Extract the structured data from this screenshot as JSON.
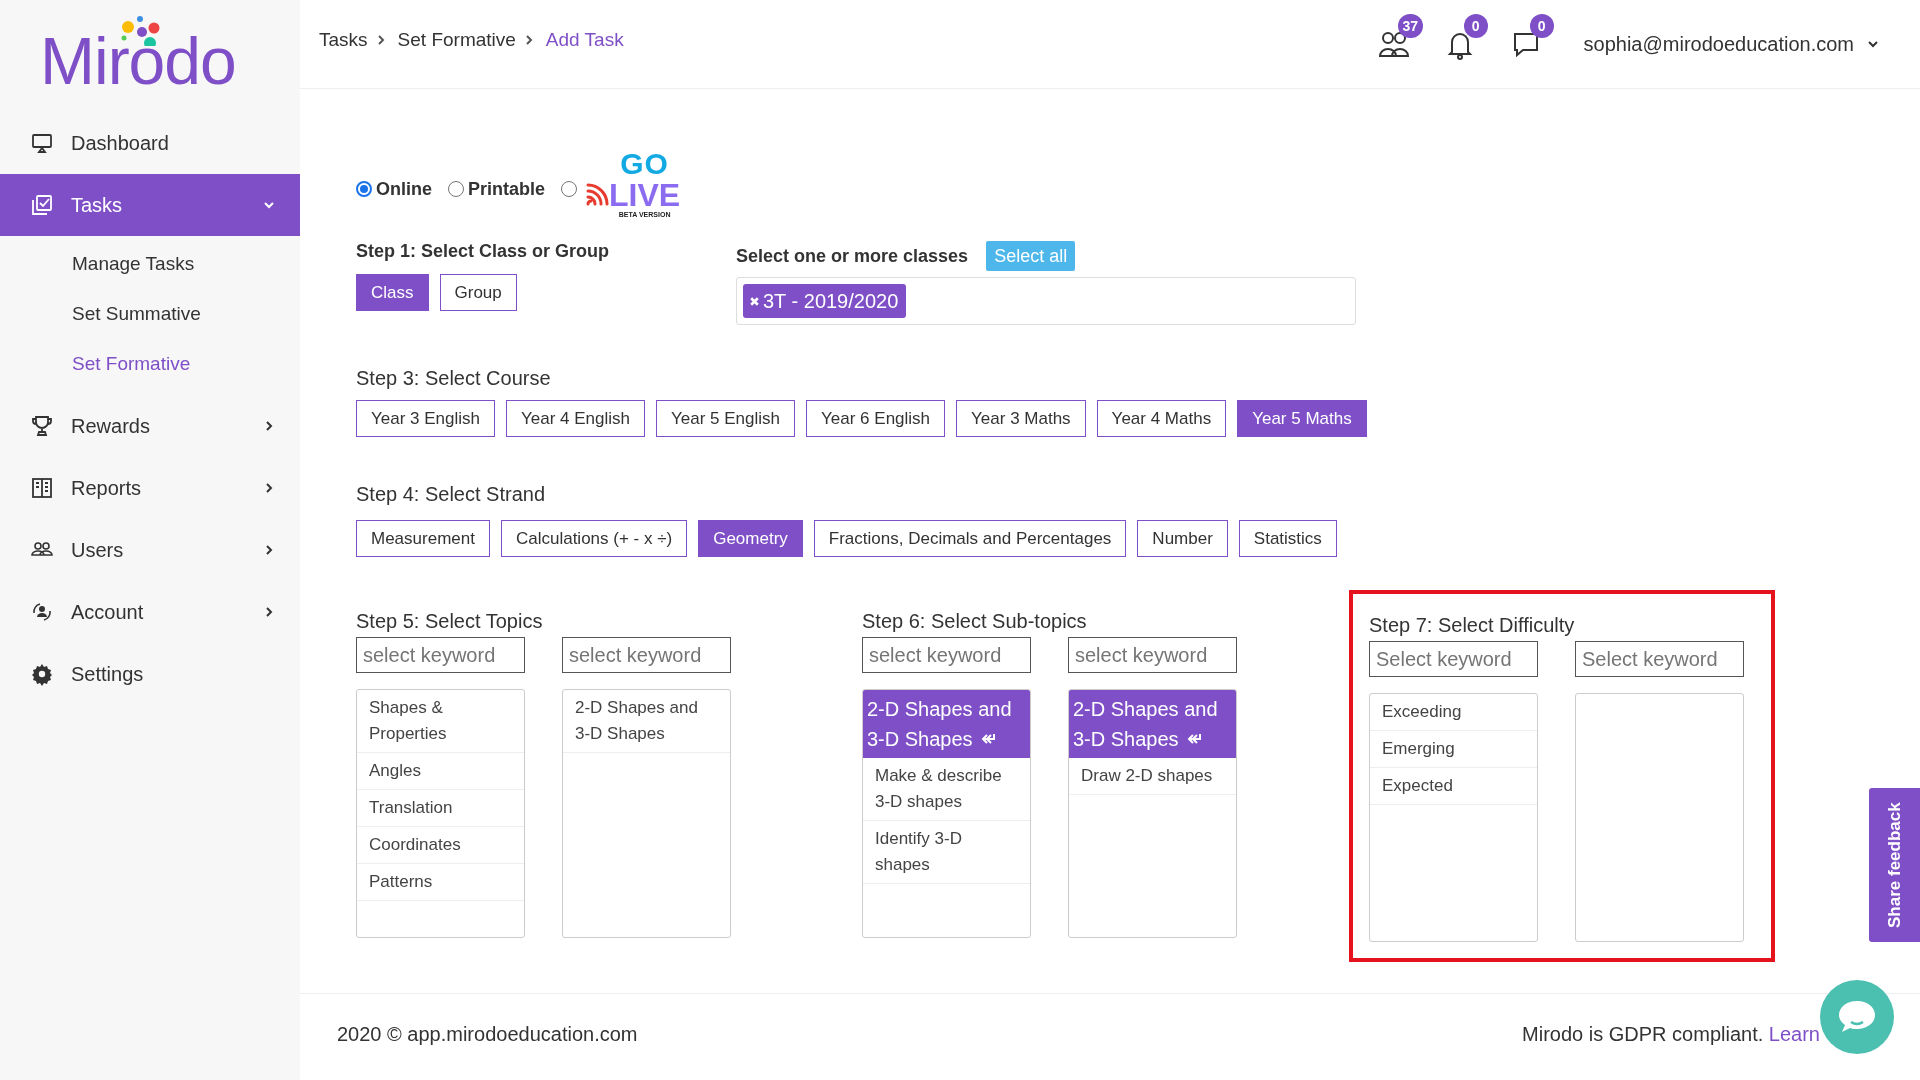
{
  "logo": "Mirodo",
  "sidebar": {
    "items": [
      {
        "label": "Dashboard",
        "kind": "link",
        "selected": false
      },
      {
        "label": "Tasks",
        "kind": "menu",
        "selected": true,
        "expanded": true,
        "children": [
          {
            "label": "Manage Tasks",
            "selected": false
          },
          {
            "label": "Set Summative",
            "selected": false
          },
          {
            "label": "Set Formative",
            "selected": true
          }
        ]
      },
      {
        "label": "Rewards",
        "kind": "menu",
        "selected": false,
        "expanded": false
      },
      {
        "label": "Reports",
        "kind": "menu",
        "selected": false,
        "expanded": false
      },
      {
        "label": "Users",
        "kind": "menu",
        "selected": false,
        "expanded": false
      },
      {
        "label": "Account",
        "kind": "menu",
        "selected": false,
        "expanded": false
      },
      {
        "label": "Settings",
        "kind": "link",
        "selected": false
      }
    ]
  },
  "header": {
    "breadcrumb": [
      {
        "label": "Tasks",
        "current": false
      },
      {
        "label": "Set Formative",
        "current": false
      },
      {
        "label": "Add Task",
        "current": true
      }
    ],
    "badges": [
      "37",
      "0",
      "0"
    ],
    "user": "sophia@mirodoeducation.com"
  },
  "task_type": {
    "options": [
      {
        "kind": "text",
        "label": "Online",
        "selected": true
      },
      {
        "kind": "text",
        "label": "Printable",
        "selected": false
      },
      {
        "kind": "logo",
        "top": "GO",
        "main": "LIVE",
        "note": "BETA VERSION",
        "selected": false
      }
    ]
  },
  "step1": {
    "title": "Step 1: Select Class or Group",
    "options": [
      {
        "label": "Class",
        "selected": true
      },
      {
        "label": "Group",
        "selected": false
      }
    ]
  },
  "classes": {
    "label": "Select one or more classes",
    "select_all": "Select all",
    "tags": [
      "3T - 2019/2020"
    ]
  },
  "step3": {
    "title": "Step 3: Select Course",
    "options": [
      {
        "label": "Year 3 English",
        "selected": false
      },
      {
        "label": "Year 4 English",
        "selected": false
      },
      {
        "label": "Year 5 English",
        "selected": false
      },
      {
        "label": "Year 6 English",
        "selected": false
      },
      {
        "label": "Year 3 Maths",
        "selected": false
      },
      {
        "label": "Year 4 Maths",
        "selected": false
      },
      {
        "label": "Year 5 Maths",
        "selected": true
      }
    ]
  },
  "step4": {
    "title": "Step 4: Select Strand",
    "options": [
      {
        "label": "Measurement",
        "selected": false
      },
      {
        "label": "Calculations (+ - x ÷)",
        "selected": false
      },
      {
        "label": "Geometry",
        "selected": true
      },
      {
        "label": "Fractions, Decimals and Percentages",
        "selected": false
      },
      {
        "label": "Number",
        "selected": false
      },
      {
        "label": "Statistics",
        "selected": false
      }
    ]
  },
  "step5": {
    "title": "Step 5: Select Topics",
    "highlighted": false,
    "columns": [
      {
        "placeholder": "select keyword",
        "items": [
          {
            "label": "Shapes & Properties",
            "selected": false
          },
          {
            "label": "Angles",
            "selected": false
          },
          {
            "label": "Translation",
            "selected": false
          },
          {
            "label": "Coordinates",
            "selected": false
          },
          {
            "label": "Patterns",
            "selected": false
          }
        ]
      },
      {
        "placeholder": "select keyword",
        "items": [
          {
            "label": "2-D Shapes and 3-D Shapes",
            "selected": false
          }
        ]
      }
    ]
  },
  "step6": {
    "title": "Step 6: Select Sub-topics",
    "highlighted": false,
    "columns": [
      {
        "placeholder": "select keyword",
        "items": [
          {
            "label": "2-D Shapes and 3-D Shapes",
            "selected": true
          },
          {
            "label": "Make & describe 3-D shapes",
            "selected": false
          },
          {
            "label": "Identify 3-D shapes",
            "selected": false
          }
        ]
      },
      {
        "placeholder": "select keyword",
        "items": [
          {
            "label": "2-D Shapes and 3-D Shapes",
            "selected": true
          },
          {
            "label": "Draw 2-D shapes",
            "selected": false
          }
        ]
      }
    ]
  },
  "step7": {
    "title": "Step 7: Select Difficulty",
    "highlighted": true,
    "columns": [
      {
        "placeholder": "Select keyword",
        "items": [
          {
            "label": "Exceeding",
            "selected": false
          },
          {
            "label": "Emerging",
            "selected": false
          },
          {
            "label": "Expected",
            "selected": false
          }
        ]
      },
      {
        "placeholder": "Select keyword"
      }
    ]
  },
  "footer": {
    "copyright": "2020 © app.mirodoeducation.com",
    "gdpr": "Mirodo is GDPR compliant.",
    "link": "Learn"
  },
  "feedback": "Share feedback"
}
